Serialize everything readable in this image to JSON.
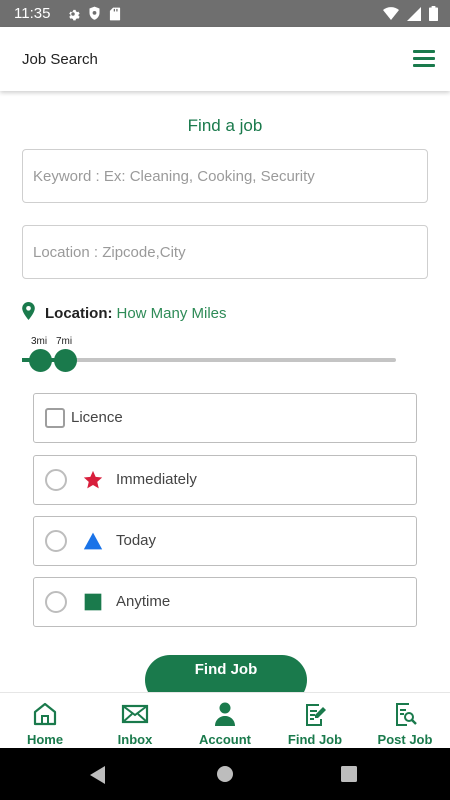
{
  "status_bar": {
    "time": "11:35",
    "left_icons": [
      "gear-icon",
      "shield-icon",
      "sd-card-icon"
    ],
    "right_icons": [
      "wifi-icon",
      "signal-icon",
      "battery-icon"
    ]
  },
  "app_bar": {
    "title": "Job Search",
    "menu_icon": "hamburger-menu-icon"
  },
  "form": {
    "heading": "Find a job",
    "keyword_placeholder": "Keyword : Ex: Cleaning, Cooking, Security",
    "keyword_value": "",
    "location_placeholder": "Location : Zipcode,City",
    "location_value": "",
    "location_label": "Location:",
    "location_link": "How Many Miles",
    "slider": {
      "min_label": "3mi",
      "max_label": "7mi",
      "min_value": 3,
      "max_value": 7
    },
    "licence_label": "Licence",
    "options": [
      {
        "label": "Immediately",
        "icon": "star-icon",
        "color": "#d81f3c"
      },
      {
        "label": "Today",
        "icon": "triangle-icon",
        "color": "#1a73e8"
      },
      {
        "label": "Anytime",
        "icon": "square-icon",
        "color": "#1a7a4c"
      }
    ],
    "submit_label": "Find Job"
  },
  "bottom_nav": [
    {
      "label": "Home",
      "icon": "home-icon"
    },
    {
      "label": "Inbox",
      "icon": "mail-icon"
    },
    {
      "label": "Account",
      "icon": "user-icon"
    },
    {
      "label": "Find Job",
      "icon": "edit-document-icon"
    },
    {
      "label": "Post Job",
      "icon": "search-document-icon"
    }
  ],
  "colors": {
    "accent": "#1a7a4c",
    "status_bar": "#6f6f6f",
    "star": "#d81f3c",
    "triangle": "#1a73e8",
    "square": "#1a7a4c"
  }
}
